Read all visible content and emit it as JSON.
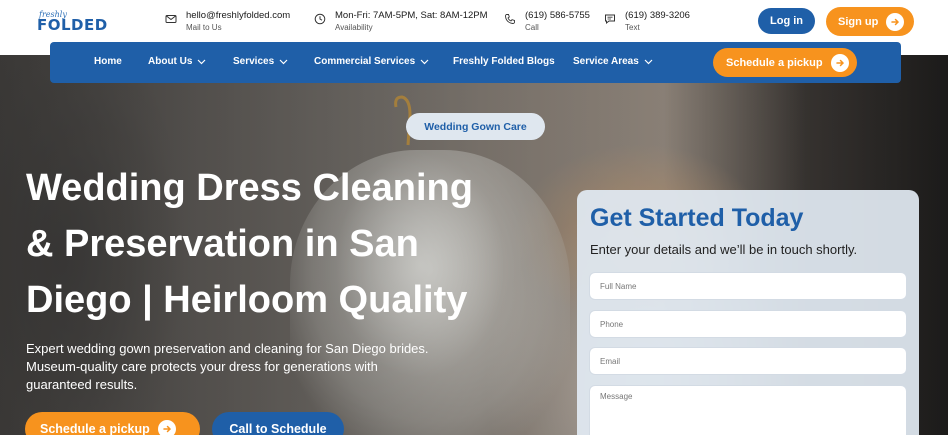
{
  "brand": {
    "logo_small": "freshly",
    "logo_big": "FOLDED"
  },
  "contacts": [
    {
      "icon": "mail-icon",
      "main": "hello@freshlyfolded.com",
      "sub": "Mail to Us"
    },
    {
      "icon": "clock-icon",
      "main": "Mon-Fri: 7AM-5PM, Sat: 8AM-12PM",
      "sub": "Availability"
    },
    {
      "icon": "phone-icon",
      "main": "(619) 586-5755",
      "sub": "Call"
    },
    {
      "icon": "chat-icon",
      "main": "(619) 389-3206",
      "sub": "Text"
    }
  ],
  "auth": {
    "login": "Log in",
    "signup": "Sign up"
  },
  "nav": {
    "items": [
      {
        "label": "Home"
      },
      {
        "label": "About Us"
      },
      {
        "label": "Services"
      },
      {
        "label": "Commercial Services"
      },
      {
        "label": "Freshly Folded Blogs"
      },
      {
        "label": "Service Areas"
      }
    ],
    "schedule": "Schedule a pickup"
  },
  "hero": {
    "pill": "Wedding Gown Care",
    "headline_lines": [
      "Wedding Dress Cleaning",
      "& Preservation in San",
      "Diego | Heirloom Quality"
    ],
    "sub_lines": [
      "Expert wedding gown preservation and cleaning for San Diego brides.",
      "Museum-quality care protects your dress for generations with",
      "guaranteed results."
    ],
    "btn_pickup": "Schedule a pickup",
    "btn_call": "Call to Schedule"
  },
  "form": {
    "title": "Get Started Today",
    "subtitle": "Enter your details and we’ll be in touch shortly.",
    "fields": [
      {
        "placeholder": "Full Name"
      },
      {
        "placeholder": "Phone"
      },
      {
        "placeholder": "Email"
      },
      {
        "placeholder": "Message"
      }
    ]
  },
  "colors": {
    "brand_blue": "#1f5fa8",
    "accent_orange": "#f7931e"
  }
}
